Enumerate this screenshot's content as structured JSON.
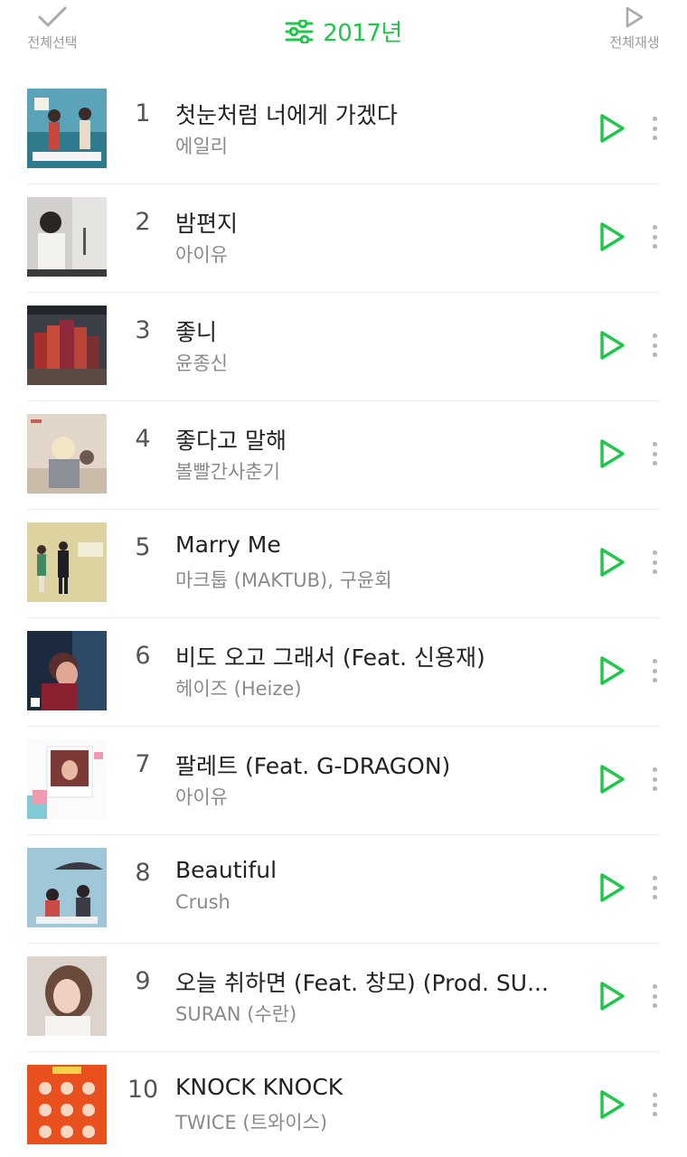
{
  "header": {
    "select_all_label": "전체선택",
    "year_label": "2017년",
    "play_all_label": "전체재생"
  },
  "accent_color": "#1ec74a",
  "icons": {
    "select_all": "check-icon",
    "filter": "sliders-icon",
    "play_all": "play-outline-icon",
    "row_play": "play-icon",
    "row_more": "more-vertical-icon"
  },
  "songs": [
    {
      "rank": "1",
      "title": "첫눈처럼 너에게 가겠다",
      "artist": "에일리"
    },
    {
      "rank": "2",
      "title": "밤편지",
      "artist": "아이유"
    },
    {
      "rank": "3",
      "title": "좋니",
      "artist": "윤종신"
    },
    {
      "rank": "4",
      "title": "좋다고 말해",
      "artist": "볼빨간사춘기"
    },
    {
      "rank": "5",
      "title": "Marry Me",
      "artist": "마크툽 (MAKTUB), 구윤회"
    },
    {
      "rank": "6",
      "title": "비도 오고 그래서 (Feat. 신용재)",
      "artist": "헤이즈 (Heize)"
    },
    {
      "rank": "7",
      "title": "팔레트 (Feat. G-DRAGON)",
      "artist": "아이유"
    },
    {
      "rank": "8",
      "title": "Beautiful",
      "artist": "Crush"
    },
    {
      "rank": "9",
      "title": "오늘 취하면 (Feat. 창모) (Prod. SU...",
      "artist": "SURAN (수란)"
    },
    {
      "rank": "10",
      "title": "KNOCK KNOCK",
      "artist": "TWICE (트와이스)"
    }
  ]
}
